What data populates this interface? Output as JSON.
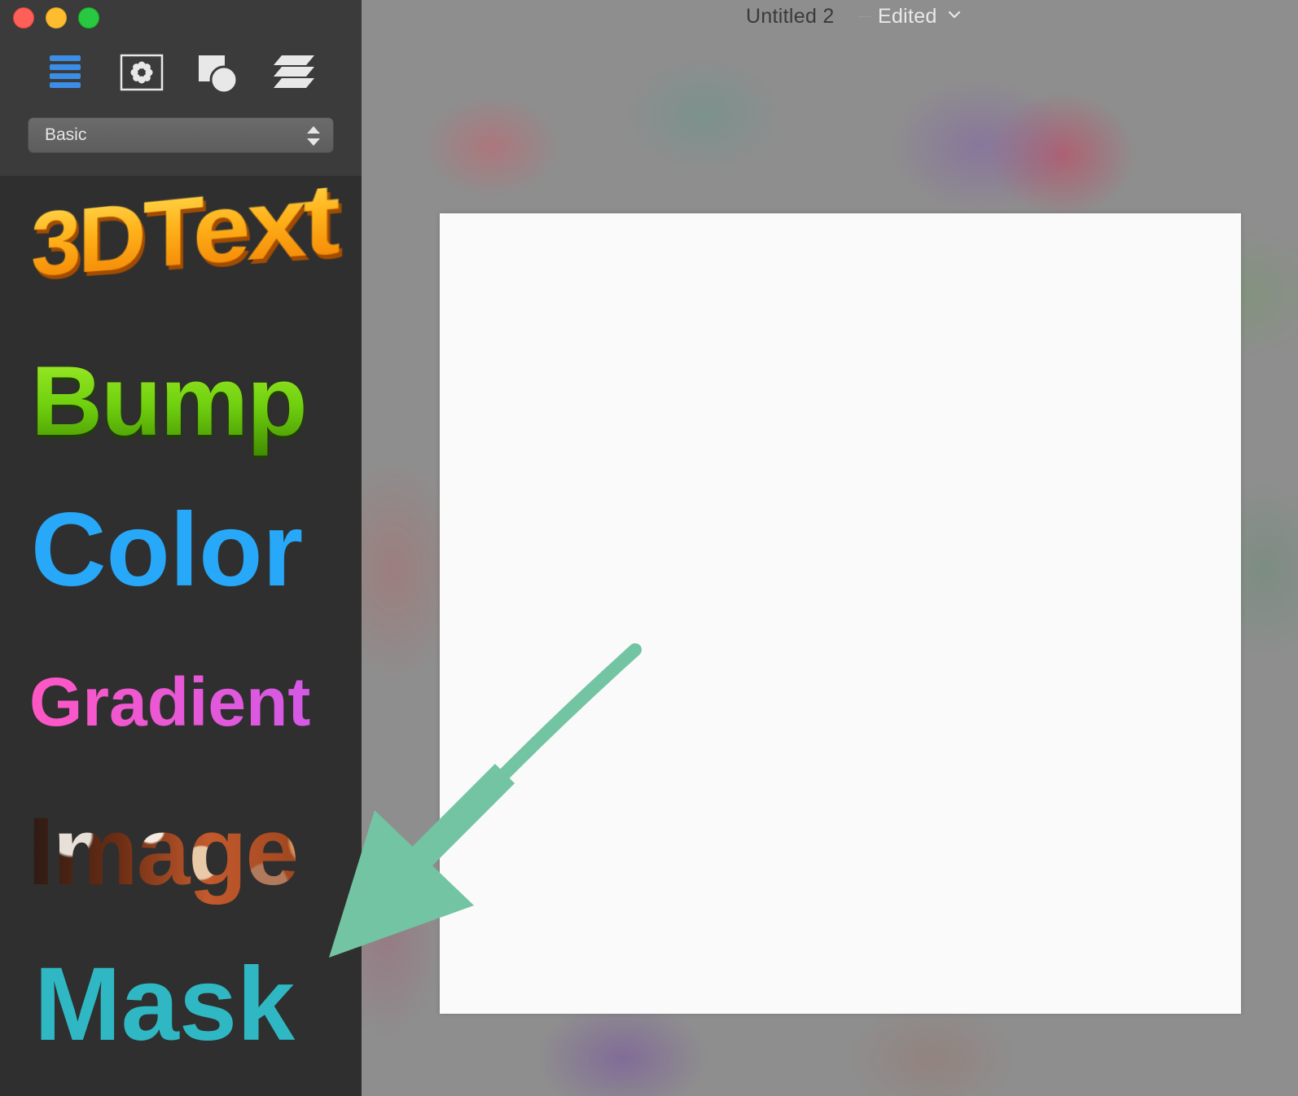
{
  "window": {
    "title": "Untitled 2",
    "status": "Edited",
    "status_icon": "chevron-down-icon"
  },
  "sidebar": {
    "toolbar": [
      {
        "icon": "list-lines-icon"
      },
      {
        "icon": "effects-flower-icon"
      },
      {
        "icon": "shapes-icon"
      },
      {
        "icon": "layers-icon"
      }
    ],
    "preset_select": {
      "value": "Basic"
    },
    "styles": [
      {
        "label": "3DText"
      },
      {
        "label": "Bump"
      },
      {
        "label": "Color"
      },
      {
        "label": "Gradient"
      },
      {
        "label": "Image"
      },
      {
        "label": "Mask"
      }
    ]
  },
  "colors": {
    "sidebar_bg": "#2f2f2f",
    "sidebar_top_bg": "#3b3b3b",
    "canvas_page": "#fafafa",
    "annotation_arrow": "#72c4a3",
    "style_3d": "#ffb21a",
    "style_bump": "#6fcf0e",
    "style_color": "#28a8f8",
    "style_gradient": "#e057d8",
    "style_mask": "#2fb8c4"
  }
}
